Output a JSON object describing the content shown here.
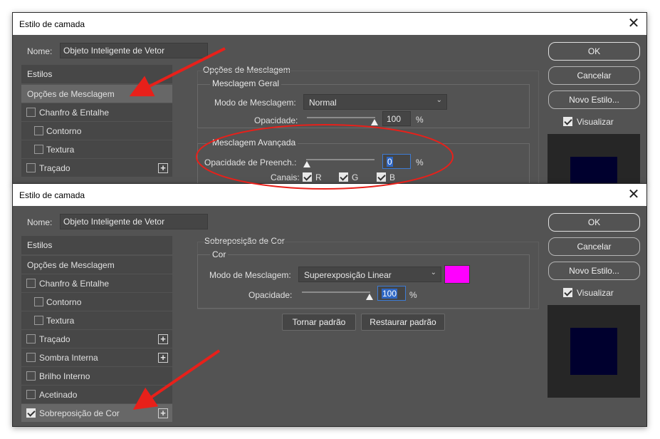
{
  "dialog1": {
    "title": "Estilo de camada",
    "name_label": "Nome:",
    "name_value": "Objeto Inteligente de Vetor",
    "styles_heading": "Estilos",
    "list": [
      {
        "label": "Opções de Mesclagem",
        "selected": true
      },
      {
        "label": "Chanfro & Entalhe",
        "checkbox": true
      },
      {
        "label": "Contorno",
        "checkbox": true,
        "indent": true
      },
      {
        "label": "Textura",
        "checkbox": true,
        "indent": true
      },
      {
        "label": "Traçado",
        "checkbox": true,
        "plus": true
      }
    ],
    "section_title": "Opções de Mesclagem",
    "general": {
      "title": "Mesclagem Geral",
      "mode_label": "Modo de Mesclagem:",
      "mode_value": "Normal",
      "opacity_label": "Opacidade:",
      "opacity_value": "100",
      "opacity_unit": "%",
      "opacity_level": 1.0
    },
    "advanced": {
      "title": "Mesclagem Avançada",
      "fill_label": "Opacidade de Preench.:",
      "fill_value": "0",
      "fill_unit": "%",
      "fill_level": 0.0,
      "channels_label": "Canais:",
      "channels": [
        "R",
        "G",
        "B"
      ]
    },
    "buttons": {
      "ok": "OK",
      "cancel": "Cancelar",
      "new_style": "Novo Estilo..."
    },
    "preview_label": "Visualizar"
  },
  "dialog2": {
    "title": "Estilo de camada",
    "name_label": "Nome:",
    "name_value": "Objeto Inteligente de Vetor",
    "styles_heading": "Estilos",
    "list": [
      {
        "label": "Opções de Mesclagem"
      },
      {
        "label": "Chanfro & Entalhe",
        "checkbox": true
      },
      {
        "label": "Contorno",
        "checkbox": true,
        "indent": true
      },
      {
        "label": "Textura",
        "checkbox": true,
        "indent": true
      },
      {
        "label": "Traçado",
        "checkbox": true,
        "plus": true
      },
      {
        "label": "Sombra Interna",
        "checkbox": true,
        "plus": true
      },
      {
        "label": "Brilho Interno",
        "checkbox": true
      },
      {
        "label": "Acetinado",
        "checkbox": true
      },
      {
        "label": "Sobreposição de Cor",
        "checkbox": true,
        "checked": true,
        "plus": true
      }
    ],
    "section_title": "Sobreposição de Cor",
    "color_group": {
      "title": "Cor",
      "mode_label": "Modo de Mesclagem:",
      "mode_value": "Superexposição Linear",
      "swatch_color": "#ff00ff",
      "opacity_label": "Opacidade:",
      "opacity_value": "100",
      "opacity_unit": "%",
      "opacity_level": 1.0
    },
    "make_default": "Tornar padrão",
    "reset_default": "Restaurar padrão",
    "buttons": {
      "ok": "OK",
      "cancel": "Cancelar",
      "new_style": "Novo Estilo..."
    },
    "preview_label": "Visualizar"
  },
  "annotation_color": "#e8201a"
}
